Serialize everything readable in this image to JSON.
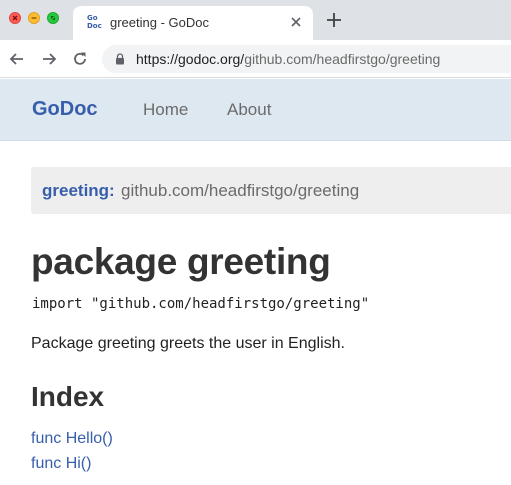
{
  "browser": {
    "tab": {
      "title": "greeting - GoDoc",
      "favicon_top": "Go",
      "favicon_bottom": "Doc"
    },
    "omnibox": {
      "url_host": "https://godoc.org/",
      "url_path": "github.com/headfirstgo/greeting"
    }
  },
  "site": {
    "brand": "GoDoc",
    "nav": {
      "home": "Home",
      "about": "About"
    }
  },
  "breadcrumb": {
    "package": "greeting:",
    "path": "github.com/headfirstgo/greeting"
  },
  "content": {
    "title": "package greeting",
    "import": "import \"github.com/headfirstgo/greeting\"",
    "doc": "Package greeting greets the user in English.",
    "index_title": "Index",
    "index_items": [
      "func Hello()",
      "func Hi()"
    ]
  },
  "colors": {
    "brand": "#375eab",
    "navbar": "#dde8f1",
    "tabstrip": "#dee1e6"
  }
}
